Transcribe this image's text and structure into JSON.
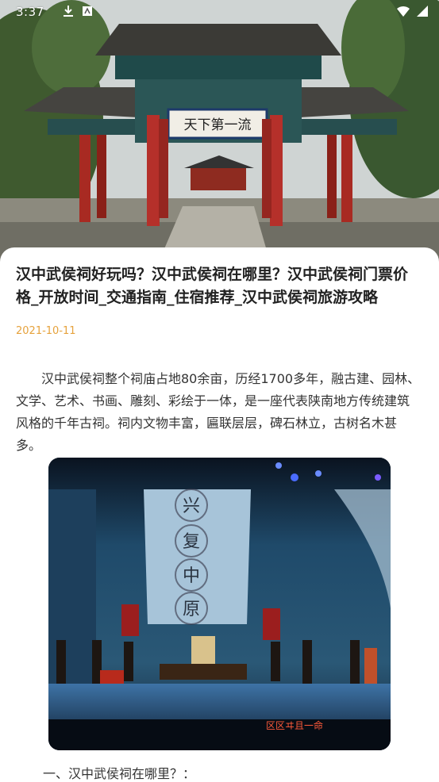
{
  "status_bar": {
    "time": "3:37",
    "left_icons": [
      "photo-icon",
      "download-icon",
      "notification-icon"
    ],
    "right_icons": [
      "wifi-icon",
      "signal-icon"
    ]
  },
  "hero": {
    "signboard_text": "天下第一流"
  },
  "article": {
    "title": "汉中武侯祠好玩吗？汉中武侯祠在哪里？汉中武侯祠门票价格_开放时间_交通指南_住宿推荐_汉中武侯祠旅游攻略",
    "date": "2021-10-11",
    "paragraph": "汉中武侯祠整个祠庙占地80余亩，历经1700多年，融古建、园林、文学、艺术、书画、雕刻、彩绘于一体，是一座代表陕南地方传统建筑风格的千年古祠。祠内文物丰富，匾联层层，碑石林立，古树名木甚多。",
    "photo": {
      "banner_text": "兴复中原",
      "subtitle_text": "区区ヰ且一命"
    },
    "section_heading": "一、汉中武侯祠在哪里？："
  },
  "colors": {
    "date": "#e6a23c",
    "title": "#222222",
    "body_text": "#333333"
  }
}
